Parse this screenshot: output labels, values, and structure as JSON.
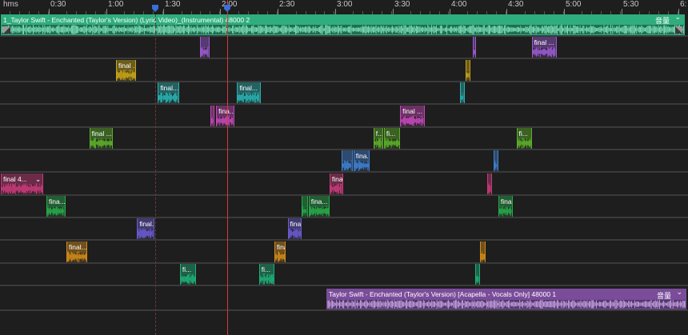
{
  "ruler": {
    "labels": [
      {
        "text": "hms",
        "t": 0
      },
      {
        "text": "0:30",
        "t": 30
      },
      {
        "text": "1:00",
        "t": 60
      },
      {
        "text": "1:30",
        "t": 90
      },
      {
        "text": "2:00",
        "t": 120
      },
      {
        "text": "2:30",
        "t": 150
      },
      {
        "text": "3:00",
        "t": 180
      },
      {
        "text": "3:30",
        "t": 210
      },
      {
        "text": "4:00",
        "t": 240
      },
      {
        "text": "4:30",
        "t": 270
      },
      {
        "text": "5:00",
        "t": 300
      },
      {
        "text": "5:30",
        "t": 330
      },
      {
        "text": "6:",
        "t": 360
      }
    ]
  },
  "playhead_time": 118.5,
  "in_point_time": 80.5,
  "instrumental_clip": {
    "title": "1_Taylor Swift - Enchanted (Taylor's Version) (Lyric Video)_(Instrumental) 48000 2",
    "channel_label": "音量",
    "color": "#2fae7d"
  },
  "vocals_clip": {
    "title": "Taylor Swift - Enchanted (Taylor's Version) [Acapella - Vocals Only] 48000 1",
    "channel_label": "音量",
    "color": "#7a4c9a"
  },
  "tracks": [
    {
      "color": "#9a5ad0",
      "clips": [
        {
          "start": 104,
          "end": 109,
          "label": ""
        },
        {
          "start": 247,
          "end": 249,
          "label": ""
        },
        {
          "start": 278,
          "end": 291,
          "label": "final ..."
        }
      ]
    },
    {
      "color": "#c8a418",
      "clips": [
        {
          "start": 60,
          "end": 70.5,
          "label": "final ..."
        },
        {
          "start": 243.5,
          "end": 246,
          "label": ""
        }
      ]
    },
    {
      "color": "#2ab0b0",
      "clips": [
        {
          "start": 82,
          "end": 93,
          "label": "final..."
        },
        {
          "start": 123.5,
          "end": 136,
          "label": "final..."
        },
        {
          "start": 240.5,
          "end": 243,
          "label": ""
        }
      ]
    },
    {
      "color": "#c247b8",
      "clips": [
        {
          "start": 109.5,
          "end": 111.5,
          "label": ""
        },
        {
          "start": 112.5,
          "end": 122,
          "label": "fina..."
        },
        {
          "start": 209,
          "end": 222,
          "label": "final ..."
        }
      ]
    },
    {
      "color": "#5cae2a",
      "clips": [
        {
          "start": 46,
          "end": 58.5,
          "label": "final ..."
        },
        {
          "start": 195,
          "end": 200,
          "label": "f..."
        },
        {
          "start": 200.5,
          "end": 209,
          "label": "fi..."
        },
        {
          "start": 270,
          "end": 278,
          "label": "fi..."
        }
      ]
    },
    {
      "color": "#3f7fcf",
      "clips": [
        {
          "start": 178.5,
          "end": 184,
          "label": ""
        },
        {
          "start": 184.5,
          "end": 193,
          "label": "fina..."
        },
        {
          "start": 258,
          "end": 260.5,
          "label": ""
        }
      ]
    },
    {
      "color": "#c73a7a",
      "clips": [
        {
          "start": 0,
          "end": 22,
          "label": "final 4..."
        },
        {
          "start": 172,
          "end": 179,
          "label": "final ..."
        },
        {
          "start": 254.5,
          "end": 257,
          "label": ""
        }
      ]
    },
    {
      "color": "#28a84a",
      "clips": [
        {
          "start": 23.5,
          "end": 33.5,
          "label": "fina..."
        },
        {
          "start": 157.5,
          "end": 160.5,
          "label": ""
        },
        {
          "start": 161,
          "end": 172,
          "label": "fina..."
        },
        {
          "start": 260.5,
          "end": 268,
          "label": "fina..."
        }
      ]
    },
    {
      "color": "#6a5ad0",
      "clips": [
        {
          "start": 71,
          "end": 80,
          "label": "final..."
        },
        {
          "start": 150,
          "end": 157.5,
          "label": "fina..."
        }
      ]
    },
    {
      "color": "#d08a18",
      "clips": [
        {
          "start": 34,
          "end": 45,
          "label": "final..."
        },
        {
          "start": 143,
          "end": 149,
          "label": "fina..."
        },
        {
          "start": 251,
          "end": 254,
          "label": ""
        }
      ]
    },
    {
      "color": "#1fae78",
      "clips": [
        {
          "start": 93.5,
          "end": 102,
          "label": "fi..."
        },
        {
          "start": 135,
          "end": 143,
          "label": "fi..."
        },
        {
          "start": 248.5,
          "end": 251,
          "label": ""
        }
      ]
    }
  ]
}
